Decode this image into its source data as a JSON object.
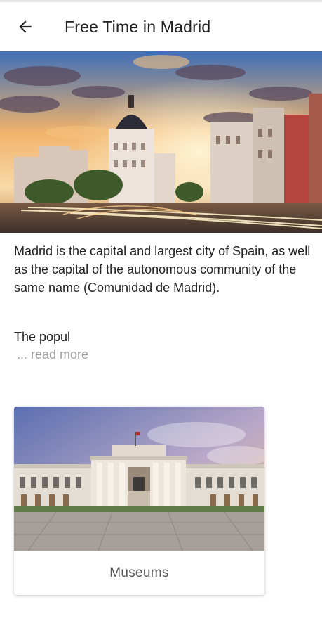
{
  "header": {
    "title": "Free Time in Madrid",
    "back_icon": "arrow-left-icon"
  },
  "hero": {
    "image": "madrid-gran-via-metropolis-building-photo"
  },
  "description": {
    "text": "Madrid is the capital and largest city of Spain, as well as the capital of the autonomous community of the same name (Comunidad de Madrid).",
    "truncated": "The popul",
    "read_more": "... read more"
  },
  "categories": [
    {
      "label": "Museums",
      "image": "prado-museum-photo"
    }
  ],
  "colors": {
    "text": "#212121",
    "muted": "#9e9e9e",
    "label": "#555555"
  }
}
